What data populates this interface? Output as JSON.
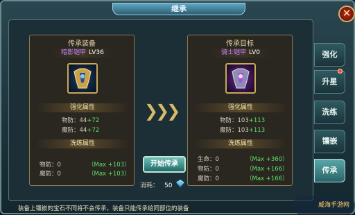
{
  "window": {
    "title": "继承",
    "close": "✕"
  },
  "source": {
    "title": "传承装备",
    "item_name": "暗影铠甲",
    "level": "LV36",
    "enhance_header": "强化属性",
    "enhance": [
      {
        "label": "物防：",
        "value": "44",
        "bonus": "+72"
      },
      {
        "label": "魔防：",
        "value": "44",
        "bonus": "+72"
      }
    ],
    "refine_header": "洗练属性",
    "refine": [
      {
        "label": "物防：",
        "value": "0",
        "max": "（Max +103）"
      },
      {
        "label": "魔防：",
        "value": "0",
        "max": "（Max +103）"
      }
    ]
  },
  "target": {
    "title": "传承目标",
    "item_name": "骑士铠甲",
    "level": "LV0",
    "enhance_header": "强化属性",
    "enhance": [
      {
        "label": "物防：",
        "value": "103",
        "bonus": "+113"
      },
      {
        "label": "魔防：",
        "value": "103",
        "bonus": "+113"
      }
    ],
    "refine_header": "洗练属性",
    "refine": [
      {
        "label": "生命：",
        "value": "0",
        "max": "（Max +360）"
      },
      {
        "label": "物防：",
        "value": "0",
        "max": "（Max +166）"
      },
      {
        "label": "魔防：",
        "value": "0",
        "max": "（Max +166）"
      }
    ]
  },
  "action": {
    "start": "开始传承",
    "cost_label": "消耗：",
    "cost_value": "50"
  },
  "tabs": [
    "强化",
    "升星",
    "洗练",
    "镶嵌",
    "传承"
  ],
  "footer": "装备上镶嵌的宝石不同将不会传承，装备只能传承给同部位的装备",
  "watermark": "威海手游网",
  "colors": {
    "green": "#5fe06a",
    "purple_name": "#c983ff",
    "gold": "#d9b96a"
  },
  "icons": {
    "source_item": "armor-gold-icon",
    "target_item": "armor-purple-icon",
    "gem": "diamond-icon"
  }
}
